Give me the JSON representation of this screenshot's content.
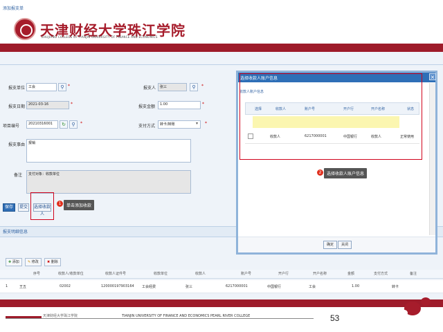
{
  "slide": {
    "school_name": "天津财经大学珠江学院",
    "school_english": "ZHUJIANG COLLEGE OF TIANJIN UNIVERSITY OF FINANCE AND ECONOMICS",
    "footer_cn": "天津财经大学珠江学院",
    "footer_en": "TIANJIN UNIVERSITY OF FINANCE AND ECONOMICS PEARL RIVER COLLEGE",
    "page_number": "53"
  },
  "app": {
    "page_title": "添加报支单",
    "form": {
      "expense_type_label": "报支单位",
      "expense_type_value": "工会",
      "applicant_label": "报支人",
      "applicant_value": "张三",
      "date_label": "报支日期",
      "date_value": "2021-03-16",
      "amount_label": "报支金额",
      "amount_value": "1.00",
      "project_no_label": "项目编号",
      "project_no_value": "20210316001",
      "payment_label": "支付方式",
      "payment_value": "转卡/转账",
      "reason_label": "报支事由",
      "reason_value": "报销",
      "remark_label": "备注",
      "remark_value": "支付对象：收款单位",
      "required_mark": "*"
    },
    "buttons": {
      "save": "保存",
      "submit": "提交",
      "select_payee": "选择收款人"
    },
    "tip_select_payee": "单击添加收款",
    "detail_section_title": "报支明细信息",
    "toolbar": {
      "add": "添加",
      "edit": "修改",
      "delete": "删除"
    },
    "detail_table": {
      "headers": [
        "序号",
        "收款人/收款单位",
        "收款人证件号",
        "收款单位",
        "收款人",
        "账户号",
        "开户行",
        "开户名称",
        "金额",
        "支付方式",
        "备注"
      ],
      "row": [
        "1",
        "王五",
        "02002",
        "120000197903164",
        "工会经费",
        "张三",
        "6217000001",
        "中国银行",
        "工会",
        "1.00",
        "转卡"
      ]
    },
    "modal": {
      "title": "选择收款人账户信息",
      "subtitle": "收款人账户信息",
      "headers": [
        "选择",
        "收款人",
        "账户号",
        "开户行",
        "开户名称",
        "状态"
      ],
      "row": [
        "",
        "收款人",
        "6217000001",
        "中国银行",
        "收款人",
        "正常使用"
      ],
      "tip": "选择收款人账户信息",
      "ok": "确定",
      "close": "关闭",
      "close_icon": "×",
      "step_badge": "2"
    },
    "step1_badge": "1"
  }
}
